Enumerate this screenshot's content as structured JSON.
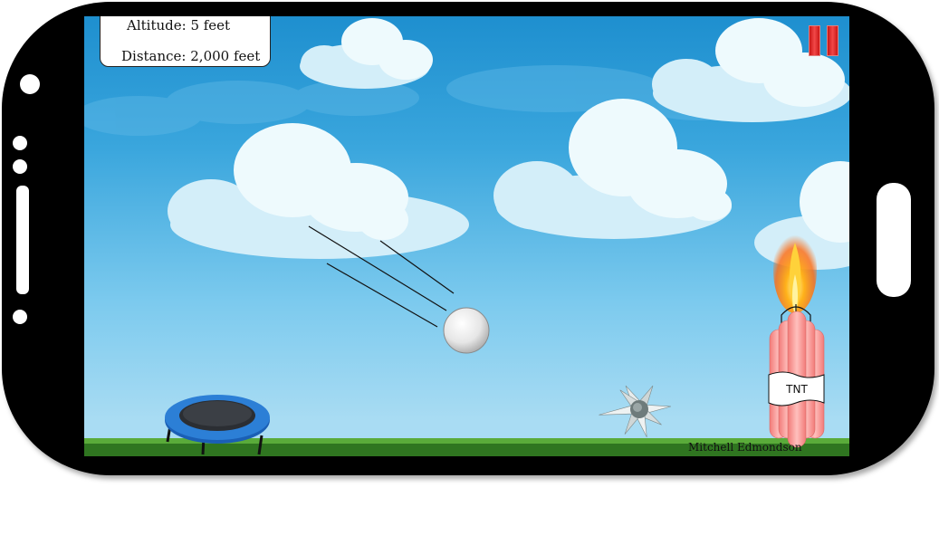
{
  "hud": {
    "altitude": "Altitude: 5 feet",
    "distance": "Distance: 2,000 feet"
  },
  "credit": "Mitchell Edmondson",
  "tnt_label": "TNT",
  "colors": {
    "sky_top": "#1e8fcf",
    "sky_bottom": "#a9dcf3",
    "ground": "#3f8a2a",
    "trampoline": "#1f6fc4",
    "pause": "#d11a1a",
    "dynamite": "#f29a98",
    "flame": "#ff9a1a"
  },
  "icons": [
    "pause-icon",
    "trampoline-icon",
    "ball-icon",
    "spike-mine-icon",
    "tnt-dynamite-icon",
    "flame-icon",
    "cloud-icon"
  ]
}
